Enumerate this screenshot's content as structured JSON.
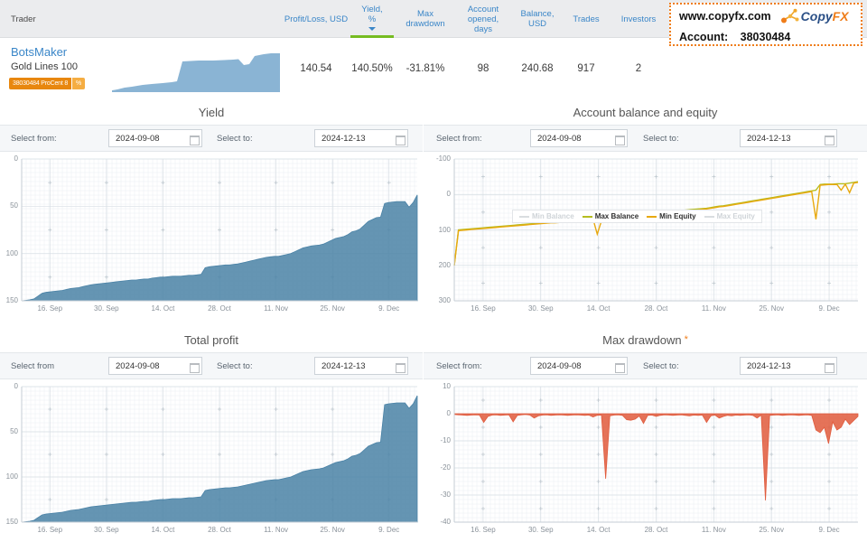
{
  "table": {
    "columns": [
      {
        "label": "Trader",
        "key": "trader"
      },
      {
        "label": "Profit/Loss, USD",
        "key": "pl"
      },
      {
        "label": "Yield, %",
        "key": "yield",
        "sorted": true
      },
      {
        "label": "Max drawdown",
        "key": "dd"
      },
      {
        "label": "Account opened, days",
        "key": "opened"
      },
      {
        "label": "Balance, USD",
        "key": "balance"
      },
      {
        "label": "Trades",
        "key": "trades"
      },
      {
        "label": "Investors",
        "key": "investors"
      }
    ],
    "header": {
      "trader": "Trader",
      "profit_loss": "Profit/Loss, USD",
      "yield_l1": "Yield,",
      "yield_l2": "%",
      "drawdown_l1": "Max",
      "drawdown_l2": "drawdown",
      "opened_l1": "Account opened,",
      "opened_l2": "days",
      "balance_l1": "Balance,",
      "balance_l2": "USD",
      "trades": "Trades",
      "investors": "Investors"
    },
    "row": {
      "name": "BotsMaker",
      "strategy": "Gold Lines 100",
      "badge_account": "38030484 ProCent 8",
      "badge_percent": "%",
      "profit_loss": "140.54",
      "yield": "140.50%",
      "max_drawdown": "-31.81%",
      "account_opened_days": "98",
      "balance": "240.68",
      "trades": "917",
      "investors": "2"
    }
  },
  "watermark": {
    "url": "www.copyfx.com",
    "logo_copy": "Copy",
    "logo_fx": "FX",
    "account_label": "Account:",
    "account_value": "38030484"
  },
  "panels": {
    "yield": {
      "title": "Yield",
      "from_label": "Select from:",
      "from_value": "2024-09-08",
      "to_label": "Select to:",
      "to_value": "2024-12-13"
    },
    "balance": {
      "title": "Account balance and equity",
      "from_label": "Select from:",
      "from_value": "2024-09-08",
      "to_label": "Select to:",
      "to_value": "2024-12-13",
      "legend": [
        {
          "label": "Min Balance",
          "color": "#d9dde0",
          "active": false
        },
        {
          "label": "Max Balance",
          "color": "#b5bd20",
          "active": true
        },
        {
          "label": "Min Equity",
          "color": "#e8a90f",
          "active": true
        },
        {
          "label": "Max Equity",
          "color": "#d9dde0",
          "active": false
        }
      ]
    },
    "profit": {
      "title": "Total profit",
      "from_label": "Select from",
      "from_value": "2024-09-08",
      "to_label": "Select to:",
      "to_value": "2024-12-13"
    },
    "drawdown": {
      "title": "Max drawdown",
      "title_star": "*",
      "from_label": "Select from:",
      "from_value": "2024-09-08",
      "to_label": "Select to:",
      "to_value": "2024-12-13"
    }
  },
  "chart_data": [
    {
      "id": "yield",
      "type": "area",
      "title": "Yield",
      "xlabel": "",
      "ylabel": "",
      "ylim": [
        0,
        150
      ],
      "yticks": [
        "0",
        "50",
        "100",
        "150"
      ],
      "xticks": [
        "16. Sep",
        "30. Sep",
        "14. Oct",
        "28. Oct",
        "11. Nov",
        "25. Nov",
        "9. Dec"
      ],
      "grid": true,
      "color": "#4a82a6",
      "x": [
        0,
        1,
        2,
        3,
        4,
        5,
        6,
        7,
        8,
        9,
        10,
        11,
        12,
        13,
        14,
        15,
        16,
        17,
        18,
        19,
        20,
        21,
        22,
        23,
        24,
        25,
        26,
        27,
        28,
        29,
        30,
        31,
        32,
        33,
        34,
        35,
        36,
        37,
        38,
        39,
        40,
        41,
        42,
        43,
        44,
        45,
        46,
        47,
        48,
        49,
        50,
        51,
        52,
        53,
        54,
        55,
        56,
        57,
        58,
        59,
        60,
        61,
        62,
        63,
        64,
        65,
        66,
        67,
        68,
        69,
        70,
        71,
        72,
        73,
        74,
        75,
        76,
        77,
        78,
        79,
        80,
        81,
        82,
        83,
        84,
        85,
        86,
        87,
        88,
        89,
        90,
        91,
        92,
        93,
        94,
        95,
        96
      ],
      "values": [
        0,
        0.5,
        1,
        2,
        5,
        8,
        9,
        9.5,
        10,
        10.5,
        11,
        12,
        13,
        13.5,
        14,
        15,
        16,
        17,
        17.5,
        18,
        18.5,
        19,
        19.5,
        20,
        20.5,
        21,
        21.5,
        22,
        22,
        22.5,
        23,
        23,
        24,
        24.5,
        25,
        25,
        25.5,
        26,
        26,
        26,
        26.5,
        27,
        27,
        27.5,
        28,
        35,
        36,
        36.5,
        37,
        37.5,
        38,
        38,
        38.5,
        39,
        40,
        41,
        42,
        43,
        44,
        45,
        46,
        46.5,
        47,
        47,
        48,
        49,
        50,
        52,
        54,
        56,
        57,
        58,
        58.5,
        59,
        60,
        62,
        64,
        66,
        67,
        68,
        70,
        73,
        74,
        76,
        80,
        84,
        86,
        88,
        88.5,
        103,
        104,
        104.5,
        105,
        105,
        105,
        99,
        104,
        112
      ]
    },
    {
      "id": "balance",
      "type": "line",
      "title": "Account balance and equity",
      "ylim": [
        -100,
        300
      ],
      "yticks": [
        "-100",
        "0",
        "100",
        "200",
        "300"
      ],
      "xticks": [
        "16. Sep",
        "30. Sep",
        "14. Oct",
        "28. Oct",
        "11. Nov",
        "25. Nov",
        "9. Dec"
      ],
      "grid": true,
      "series": [
        {
          "name": "Max Balance",
          "color": "#b5bd20",
          "values": [
            0,
            100,
            101,
            102,
            103,
            104,
            105,
            106,
            107,
            108,
            109,
            110,
            111,
            112,
            113,
            114,
            115,
            116,
            117,
            118,
            119,
            120,
            121,
            122,
            122,
            123,
            124,
            125,
            126,
            127,
            128,
            129,
            130,
            131,
            132,
            133,
            134,
            135,
            136,
            137,
            138,
            139,
            140,
            141,
            142,
            143,
            144,
            145,
            146,
            148,
            150,
            152,
            153,
            154,
            155,
            156,
            157,
            158,
            159,
            160,
            161,
            163,
            165,
            167,
            168,
            170,
            172,
            174,
            176,
            178,
            180,
            182,
            184,
            186,
            188,
            190,
            192,
            194,
            196,
            198,
            200,
            202,
            204,
            206,
            208,
            210,
            212,
            228,
            229,
            229,
            229,
            230,
            230,
            230,
            232,
            234,
            236
          ]
        },
        {
          "name": "Min Equity",
          "color": "#e8a90f",
          "values": [
            0,
            98,
            99,
            100,
            101,
            102,
            103,
            104,
            105,
            106,
            107,
            108,
            109,
            110,
            111,
            112,
            113,
            114,
            115,
            116,
            117,
            118,
            119,
            120,
            120,
            121,
            122,
            123,
            124,
            125,
            126,
            128,
            130,
            131,
            88,
            125,
            130,
            131,
            132,
            133,
            134,
            135,
            136,
            137,
            138,
            139,
            140,
            141,
            142,
            144,
            146,
            148,
            150,
            151,
            152,
            153,
            154,
            155,
            156,
            158,
            159,
            161,
            163,
            165,
            166,
            168,
            170,
            172,
            174,
            176,
            178,
            180,
            182,
            184,
            186,
            188,
            190,
            192,
            194,
            196,
            198,
            200,
            202,
            204,
            206,
            208,
            130,
            226,
            227,
            228,
            228,
            228,
            212,
            229,
            205,
            232,
            234
          ]
        }
      ]
    },
    {
      "id": "profit",
      "type": "area",
      "title": "Total profit",
      "ylim": [
        0,
        150
      ],
      "yticks": [
        "0",
        "50",
        "100",
        "150"
      ],
      "xticks": [
        "16. Sep",
        "30. Sep",
        "14. Oct",
        "28. Oct",
        "11. Nov",
        "25. Nov",
        "9. Dec"
      ],
      "grid": true,
      "color": "#4a82a6",
      "values": [
        0,
        0.5,
        1,
        2,
        5,
        8,
        9,
        9.5,
        10,
        10.5,
        11,
        12,
        13,
        13.5,
        14,
        15,
        16,
        17,
        17.5,
        18,
        18.5,
        19,
        19.5,
        20,
        20.5,
        21,
        21.5,
        22,
        22,
        22.5,
        23,
        23,
        24,
        24.5,
        25,
        25,
        25.5,
        26,
        26,
        26,
        26.5,
        27,
        27,
        27.5,
        28,
        35,
        36,
        36.5,
        37,
        37.5,
        38,
        38,
        38.5,
        39,
        40,
        41,
        42,
        43,
        44,
        45,
        46,
        46.5,
        47,
        47,
        48,
        49,
        50,
        52,
        54,
        56,
        57,
        58,
        58.5,
        59,
        60,
        62,
        64,
        66,
        67,
        68,
        70,
        73,
        74,
        76,
        80,
        84,
        86,
        88,
        88.5,
        130,
        131,
        131.5,
        132,
        132,
        132,
        126,
        131,
        140
      ]
    },
    {
      "id": "drawdown",
      "type": "area",
      "title": "Max drawdown",
      "ylim": [
        -40,
        10
      ],
      "yticks": [
        "10",
        "0",
        "-10",
        "-20",
        "-30",
        "-40"
      ],
      "xticks": [
        "16. Sep",
        "30. Sep",
        "14. Oct",
        "28. Oct",
        "11. Nov",
        "25. Nov",
        "9. Dec"
      ],
      "grid": true,
      "color": "#e05a3c",
      "values": [
        -0.3,
        -0.4,
        -0.5,
        -0.6,
        -0.5,
        -0.4,
        -0.5,
        -3.2,
        -1.0,
        -0.5,
        -0.4,
        -0.6,
        -0.5,
        -0.4,
        -3.0,
        -0.6,
        -0.4,
        -0.3,
        -0.5,
        -1.6,
        -0.8,
        -0.5,
        -0.4,
        -0.6,
        -0.5,
        -0.4,
        -0.5,
        -0.6,
        -0.5,
        -0.4,
        -0.5,
        -0.6,
        -0.5,
        -1.2,
        -0.6,
        -0.5,
        -24.0,
        -0.8,
        -0.5,
        -0.4,
        -0.6,
        -2.2,
        -2.4,
        -2.0,
        -0.8,
        -3.6,
        -0.6,
        -0.5,
        -1.0,
        -0.6,
        -0.4,
        -0.5,
        -0.6,
        -0.5,
        -0.4,
        -0.6,
        -0.8,
        -0.5,
        -0.6,
        -0.5,
        -3.2,
        -0.8,
        -0.5,
        -1.6,
        -1.0,
        -0.6,
        -0.8,
        -0.5,
        -0.6,
        -0.5,
        -0.4,
        -0.6,
        -1.6,
        -0.5,
        -32.0,
        -0.6,
        -0.5,
        -0.4,
        -0.6,
        -0.5,
        -0.4,
        -0.5,
        -0.6,
        -0.5,
        -0.4,
        -0.6,
        -6.0,
        -7.0,
        -5.0,
        -11.0,
        -3.0,
        -6.0,
        -5.0,
        -2.0,
        -4.0,
        -2.5,
        -1.0
      ]
    }
  ]
}
